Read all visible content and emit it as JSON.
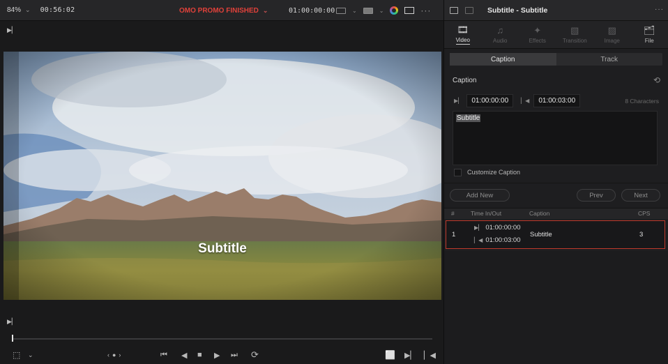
{
  "viewer": {
    "zoom": "84%",
    "timecode_left": "00:56:02",
    "project_name": "OMO PROMO FINISHED",
    "timecode_right": "01:00:00:00",
    "subtitle_overlay": "Subtitle"
  },
  "inspector": {
    "title": "Subtitle - Subtitle",
    "tabs": [
      {
        "label": "Video",
        "icon": "film-icon",
        "active": true
      },
      {
        "label": "Audio",
        "icon": "music-note-icon",
        "active": false
      },
      {
        "label": "Effects",
        "icon": "magic-wand-icon",
        "active": false
      },
      {
        "label": "Transition",
        "icon": "transition-icon",
        "active": false
      },
      {
        "label": "Image",
        "icon": "image-icon",
        "active": false
      },
      {
        "label": "File",
        "icon": "file-icon",
        "active": false
      }
    ],
    "segments": {
      "caption": "Caption",
      "track": "Track"
    },
    "caption": {
      "section_title": "Caption",
      "time_in": "01:00:00:00",
      "time_out": "01:00:03:00",
      "char_count": "8 Characters",
      "text": "Subtitle",
      "customize_label": "Customize Caption"
    },
    "buttons": {
      "add_new": "Add New",
      "prev": "Prev",
      "next": "Next"
    },
    "list": {
      "headers": {
        "num": "#",
        "time": "Time In/Out",
        "caption": "Caption",
        "cps": "CPS"
      },
      "rows": [
        {
          "num": "1",
          "time_in": "01:00:00:00",
          "time_out": "01:00:03:00",
          "caption": "Subtitle",
          "cps": "3"
        }
      ]
    }
  },
  "colors": {
    "accent_red": "#e0413a",
    "row_border": "#c0392b"
  }
}
